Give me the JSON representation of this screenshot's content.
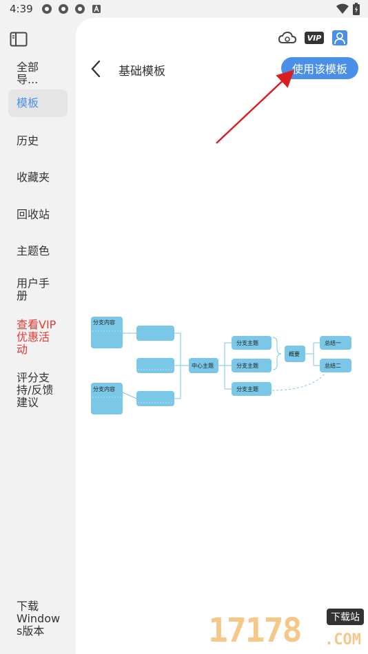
{
  "status_bar": {
    "time": "4:39"
  },
  "sidebar": {
    "items": [
      {
        "label": "全部导..."
      },
      {
        "label": "模板"
      },
      {
        "label": "历史"
      },
      {
        "label": "收藏夹"
      },
      {
        "label": "回收站"
      },
      {
        "label": "主题色"
      },
      {
        "label": "用户手\n册"
      },
      {
        "label": "查看VIP\n优惠活\n动"
      },
      {
        "label": "评分支\n持/反馈\n建议"
      },
      {
        "label": "下载\nWindow\ns版本"
      }
    ]
  },
  "header": {
    "title": "基础模板",
    "use_button": "使用该模板",
    "vip_label": "VIP"
  },
  "mindmap": {
    "branch_content_1": "分支内容",
    "branch_content_2": "分支内容",
    "center": "中心主题",
    "branch_1": "分支主题",
    "branch_2": "分支主题",
    "branch_3": "分支主题",
    "summary": "概要",
    "conclusion_1": "总结一",
    "conclusion_2": "总结二"
  },
  "watermark": {
    "digits": "17178",
    "tag": "下载站",
    "domain": ".COM"
  },
  "colors": {
    "accent": "#4a8fe7",
    "node": "#7ac7e8",
    "vip": "#e53935"
  }
}
